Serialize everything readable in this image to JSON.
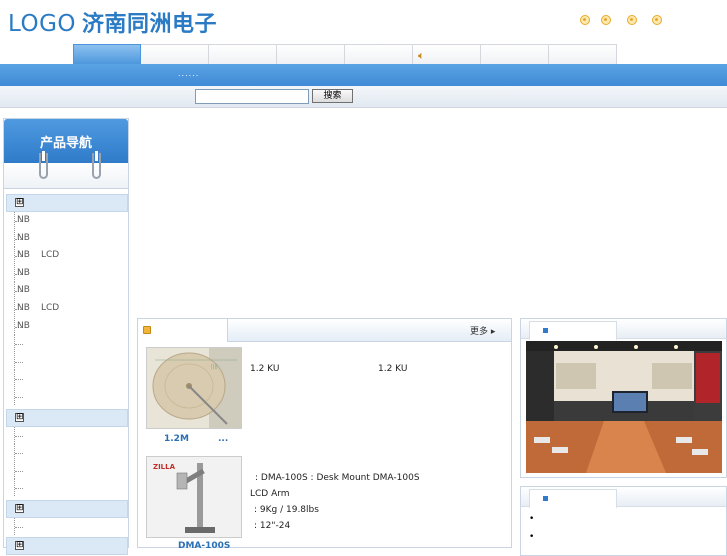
{
  "header": {
    "logo_text": "LOGO",
    "brand_text": "济南同洲电子",
    "accent": "#2a7ac4",
    "top_icons": [
      "orange-circle-icon",
      "orange-circle-icon",
      "orange-circle-icon",
      "orange-circle-icon"
    ]
  },
  "nav": {
    "tabs": [
      "",
      "",
      "",
      "",
      "",
      "",
      "",
      "",
      ""
    ],
    "active_index": 0,
    "speaker_icon": "speaker-icon"
  },
  "bluebar": {
    "marquee": "......"
  },
  "search": {
    "value": "",
    "button_label": "搜索"
  },
  "sidebar": {
    "title": "产品导航",
    "groups": [
      {
        "toggle": "⊞",
        "items": [
          {
            "label": "NB",
            "suffix": ""
          },
          {
            "label": "NB",
            "suffix": ""
          },
          {
            "label": "NB",
            "suffix": "LCD"
          },
          {
            "label": "NB",
            "suffix": ""
          },
          {
            "label": "NB",
            "suffix": ""
          },
          {
            "label": "NB",
            "suffix": "LCD"
          },
          {
            "label": "NB",
            "suffix": ""
          },
          {
            "label": "",
            "suffix": ""
          },
          {
            "label": "",
            "suffix": ""
          },
          {
            "label": "",
            "suffix": ""
          },
          {
            "label": "",
            "suffix": ""
          }
        ]
      },
      {
        "toggle": "⊞",
        "items": [
          {
            "label": "",
            "suffix": ""
          },
          {
            "label": "",
            "suffix": ""
          },
          {
            "label": "",
            "suffix": ""
          },
          {
            "label": "",
            "suffix": ""
          },
          {
            "label": "",
            "suffix": ""
          }
        ]
      },
      {
        "toggle": "⊞",
        "items": [
          {
            "label": "",
            "suffix": ""
          }
        ]
      },
      {
        "toggle": "⊞",
        "items": []
      }
    ]
  },
  "products": {
    "more_label": "更多",
    "items": [
      {
        "caption": "1.2M",
        "caption_extra": "...",
        "lines": [
          "1.2 KU",
          "1.2 KU"
        ]
      },
      {
        "caption": "DMA-100S",
        "brand_mark": "ZILLA",
        "lines": [
          ": DMA-100S    : Desk Mount     DMA-100S",
          "LCD Arm",
          ": 9Kg / 19.8lbs",
          ": 12\"-24"
        ]
      }
    ]
  },
  "right_panels": {
    "showroom_tab": "",
    "news_tab": "",
    "news_bullets": [
      "•",
      "•"
    ]
  }
}
